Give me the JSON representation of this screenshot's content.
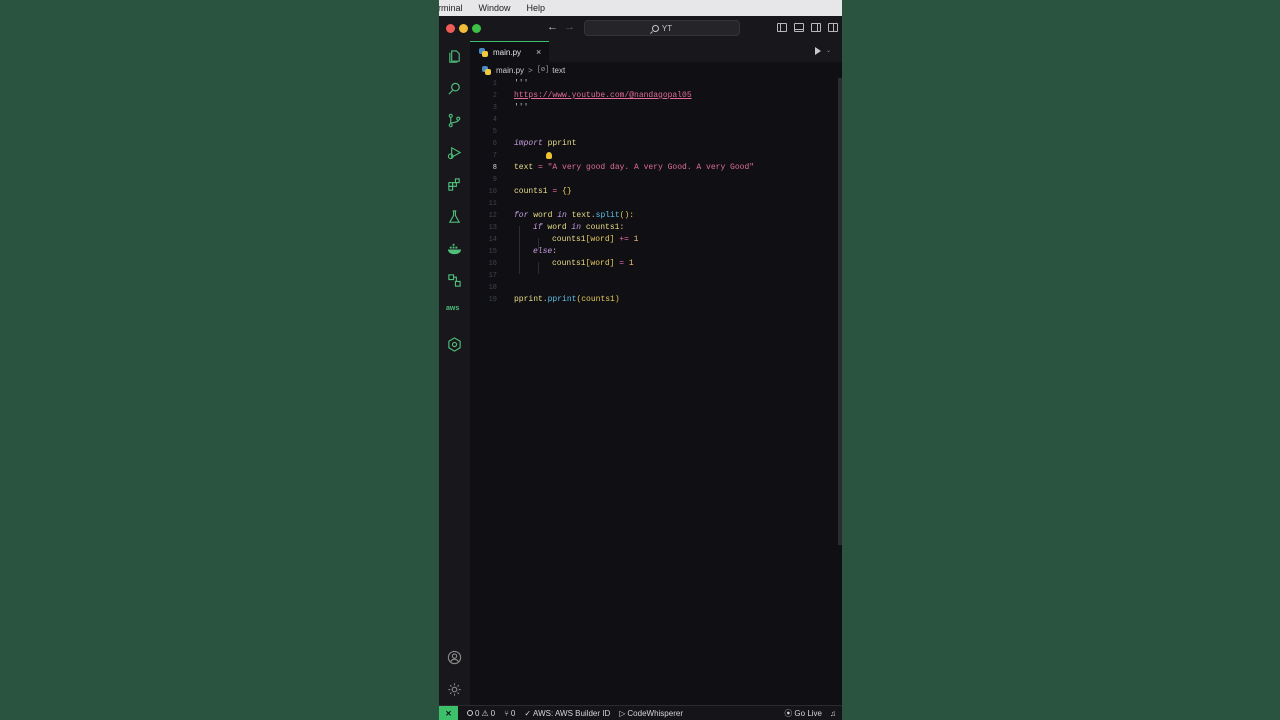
{
  "menubar": {
    "items": [
      "rminal",
      "Window",
      "Help"
    ]
  },
  "titlebar": {
    "search_text": "YT"
  },
  "tabs": [
    {
      "label": "main.py",
      "close": "×"
    }
  ],
  "breadcrumb": {
    "file": "main.py",
    "separator": ">",
    "symbol_icon": "[ø]",
    "symbol": "text"
  },
  "editor": {
    "active_line": 8,
    "lines": [
      {
        "n": "1",
        "tokens": [
          {
            "t": "'''",
            "c": "t-plain"
          }
        ]
      },
      {
        "n": "2",
        "tokens": [
          {
            "t": "https://www.youtube.com/@nandagopal05",
            "c": "t-url"
          }
        ]
      },
      {
        "n": "3",
        "tokens": [
          {
            "t": "'''",
            "c": "t-plain"
          }
        ]
      },
      {
        "n": "4",
        "tokens": []
      },
      {
        "n": "5",
        "tokens": []
      },
      {
        "n": "6",
        "tokens": [
          {
            "t": "import",
            "c": "t-kw"
          },
          {
            "t": " pprint",
            "c": "t-var"
          }
        ]
      },
      {
        "n": "7",
        "tokens": []
      },
      {
        "n": "8",
        "tokens": [
          {
            "t": "text",
            "c": "t-var"
          },
          {
            "t": " = ",
            "c": "t-op"
          },
          {
            "t": "\"A very good day. A very Good. A very Good\"",
            "c": "t-str"
          }
        ]
      },
      {
        "n": "9",
        "tokens": []
      },
      {
        "n": "10",
        "tokens": [
          {
            "t": "counts1",
            "c": "t-var"
          },
          {
            "t": " = ",
            "c": "t-op"
          },
          {
            "t": "{}",
            "c": "t-brk"
          }
        ]
      },
      {
        "n": "11",
        "tokens": []
      },
      {
        "n": "12",
        "tokens": [
          {
            "t": "for",
            "c": "t-kw"
          },
          {
            "t": " word ",
            "c": "t-var"
          },
          {
            "t": "in",
            "c": "t-kw"
          },
          {
            "t": " text",
            "c": "t-var"
          },
          {
            "t": ".",
            "c": "t-plain"
          },
          {
            "t": "split",
            "c": "t-fn"
          },
          {
            "t": "():",
            "c": "t-brk"
          }
        ]
      },
      {
        "n": "13",
        "indent": 1,
        "tokens": [
          {
            "t": "if",
            "c": "t-kw"
          },
          {
            "t": " word ",
            "c": "t-var"
          },
          {
            "t": "in",
            "c": "t-kw"
          },
          {
            "t": " counts1:",
            "c": "t-var"
          }
        ]
      },
      {
        "n": "14",
        "indent": 2,
        "tokens": [
          {
            "t": "counts1",
            "c": "t-var"
          },
          {
            "t": "[word]",
            "c": "t-brk"
          },
          {
            "t": " += ",
            "c": "t-op"
          },
          {
            "t": "1",
            "c": "t-num"
          }
        ]
      },
      {
        "n": "15",
        "indent": 1,
        "tokens": [
          {
            "t": "else",
            "c": "t-kw"
          },
          {
            "t": ":",
            "c": "t-plain"
          }
        ]
      },
      {
        "n": "16",
        "indent": 2,
        "tokens": [
          {
            "t": "counts1",
            "c": "t-var"
          },
          {
            "t": "[word]",
            "c": "t-brk"
          },
          {
            "t": " = ",
            "c": "t-op"
          },
          {
            "t": "1",
            "c": "t-num"
          }
        ]
      },
      {
        "n": "17",
        "tokens": []
      },
      {
        "n": "18",
        "tokens": []
      },
      {
        "n": "19",
        "tokens": [
          {
            "t": "pprint",
            "c": "t-var"
          },
          {
            "t": ".",
            "c": "t-plain"
          },
          {
            "t": "pprint",
            "c": "t-fn"
          },
          {
            "t": "(counts1)",
            "c": "t-brk"
          }
        ]
      }
    ]
  },
  "statusbar": {
    "remote_icon": "⨯",
    "errors": "0",
    "warnings": "0",
    "ports": "0",
    "aws": "AWS: AWS Builder ID",
    "codewhisperer": "CodeWhisperer",
    "golive": "Go Live"
  },
  "colors": {
    "accent": "#3dc06a",
    "background": "#2a5440",
    "editor_bg": "#0f0f14"
  }
}
